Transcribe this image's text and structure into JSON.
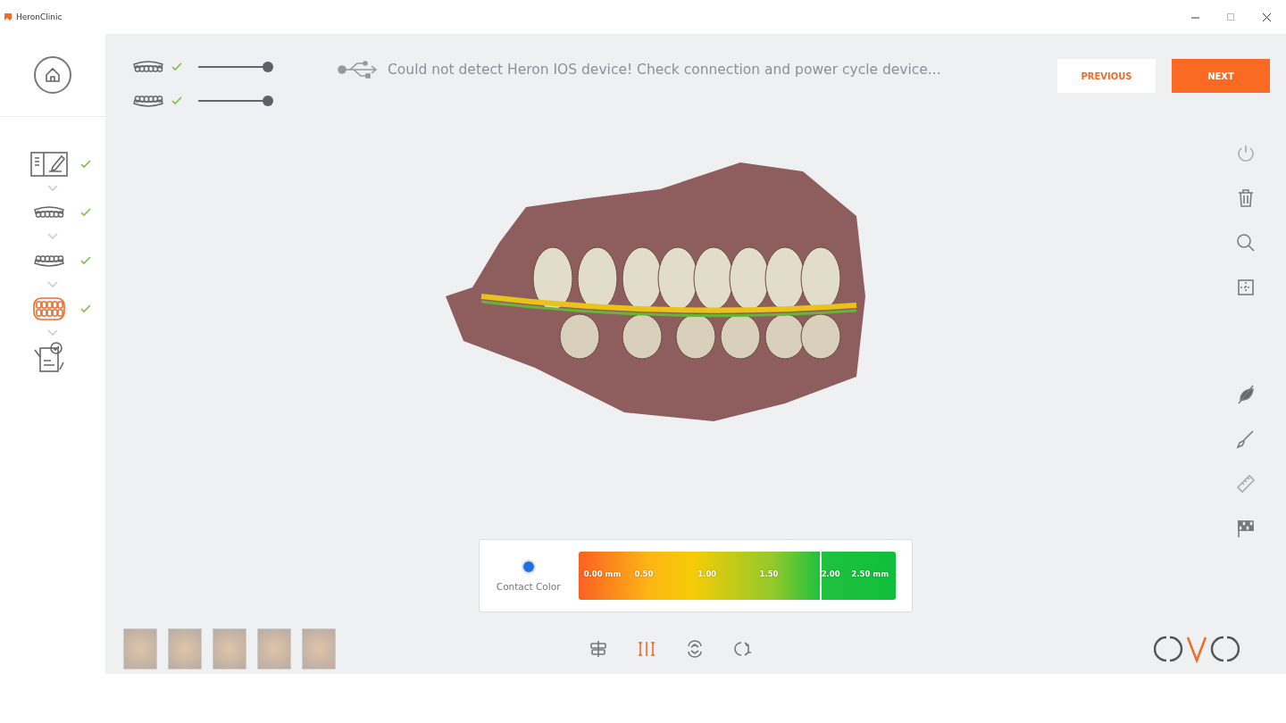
{
  "window": {
    "title": "HeronClinic"
  },
  "steps": [
    {
      "kind": "form",
      "done": true,
      "selected": false
    },
    {
      "kind": "upper",
      "done": true,
      "selected": false
    },
    {
      "kind": "lower",
      "done": true,
      "selected": false
    },
    {
      "kind": "bite",
      "done": true,
      "selected": true
    },
    {
      "kind": "report",
      "done": false,
      "selected": false
    }
  ],
  "jaws": [
    {
      "kind": "upper",
      "checked": true,
      "level": 1
    },
    {
      "kind": "lower",
      "checked": true,
      "level": 1
    }
  ],
  "status_message": "Could not detect Heron IOS device! Check connection and power cycle device...",
  "buttons": [
    {
      "label": "PREVIOUS",
      "kind": "secondary"
    },
    {
      "label": "NEXT",
      "kind": "primary"
    }
  ],
  "contact_scale": {
    "label": "Contact Color",
    "ticks": [
      "0.00 mm",
      "0.50",
      "1.00",
      "1.50",
      "2.00",
      "2.50 mm"
    ],
    "level": 0.76
  },
  "view_tools": [
    {
      "kind": "align",
      "selected": false
    },
    {
      "kind": "distance",
      "selected": true
    },
    {
      "kind": "occlusion",
      "selected": false
    },
    {
      "kind": "rotate",
      "selected": false
    }
  ]
}
